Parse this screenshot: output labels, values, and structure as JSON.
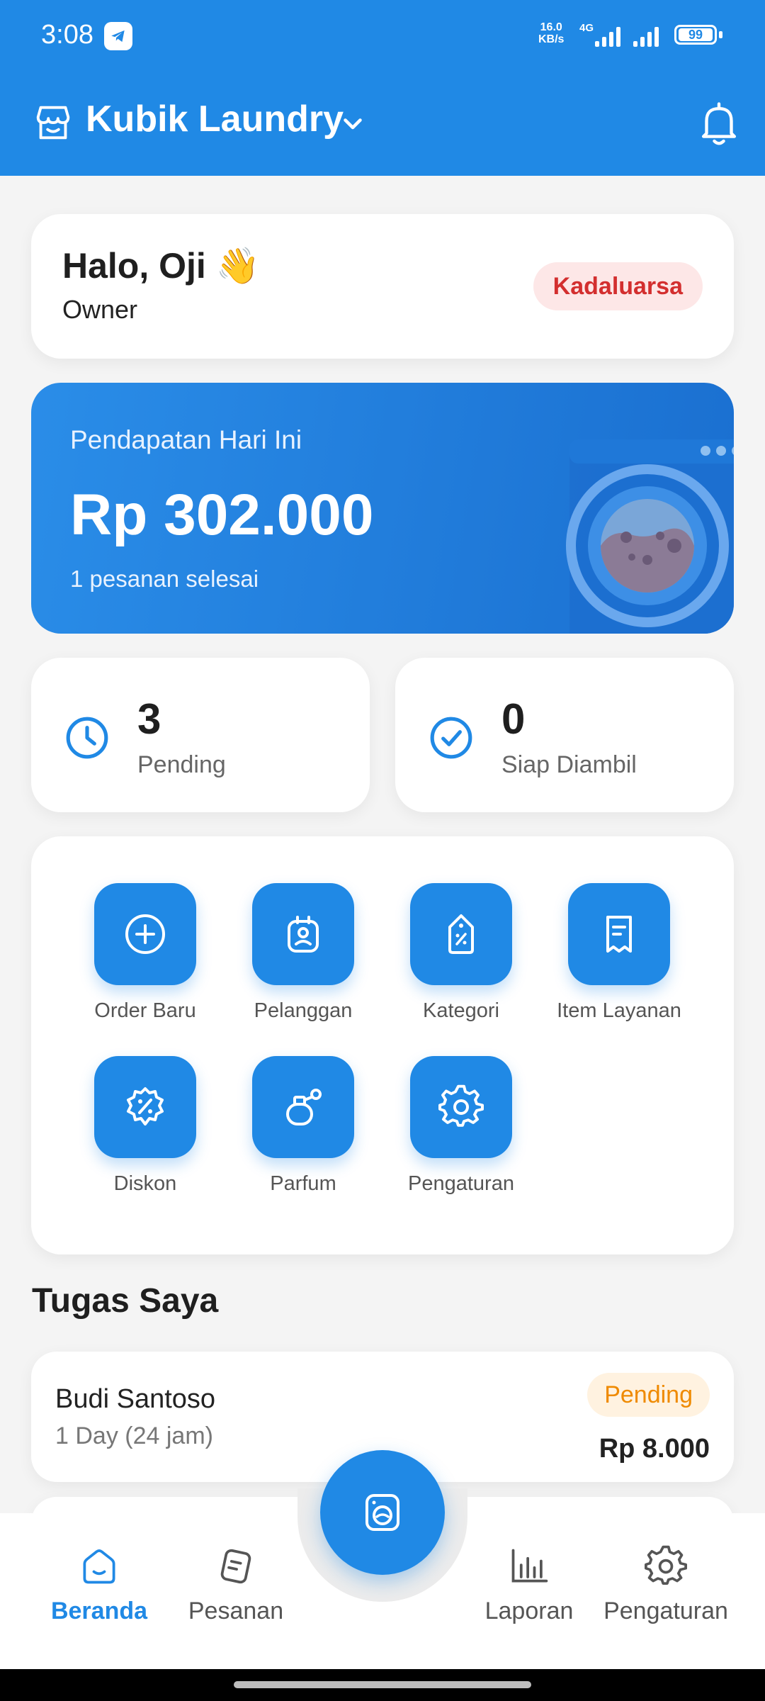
{
  "status_bar": {
    "time": "3:08",
    "net_speed_value": "16.0",
    "net_speed_unit": "KB/s",
    "net_type": "4G",
    "battery": "99"
  },
  "app_bar": {
    "store_name": "Kubik Laundry"
  },
  "greeting": {
    "title": "Halo, Oji 👋",
    "role": "Owner",
    "status_badge": "Kadaluarsa"
  },
  "revenue": {
    "label": "Pendapatan Hari Ini",
    "value": "Rp 302.000",
    "subtitle": "1 pesanan selesai"
  },
  "stats": [
    {
      "count": "3",
      "label": "Pending",
      "icon": "clock-icon"
    },
    {
      "count": "0",
      "label": "Siap Diambil",
      "icon": "check-circle-icon"
    }
  ],
  "menu": [
    {
      "label": "Order Baru",
      "icon": "plus-circle-icon"
    },
    {
      "label": "Pelanggan",
      "icon": "customer-badge-icon"
    },
    {
      "label": "Kategori",
      "icon": "tag-percent-icon"
    },
    {
      "label": "Item Layanan",
      "icon": "receipt-icon"
    },
    {
      "label": "Diskon",
      "icon": "discount-icon"
    },
    {
      "label": "Parfum",
      "icon": "perfume-icon"
    },
    {
      "label": "Pengaturan",
      "icon": "gear-icon"
    }
  ],
  "tasks_section": {
    "title": "Tugas Saya",
    "items": [
      {
        "name": "Budi Santoso",
        "service": "1 Day (24 jam)",
        "status": "Pending",
        "price": "Rp 8.000"
      }
    ]
  },
  "bottom_nav": {
    "items": [
      {
        "label": "Beranda",
        "icon": "home-icon",
        "active": true
      },
      {
        "label": "Pesanan",
        "icon": "orders-icon",
        "active": false
      },
      {
        "label": "Laporan",
        "icon": "bar-chart-icon",
        "active": false
      },
      {
        "label": "Pengaturan",
        "icon": "gear-icon",
        "active": false
      }
    ],
    "fab_icon": "washing-machine-icon"
  },
  "colors": {
    "primary": "#2089e5",
    "expired_text": "#d32f2f",
    "expired_bg": "#fde7e7",
    "pending_text": "#ef8a00",
    "pending_bg": "#fff2e0"
  }
}
